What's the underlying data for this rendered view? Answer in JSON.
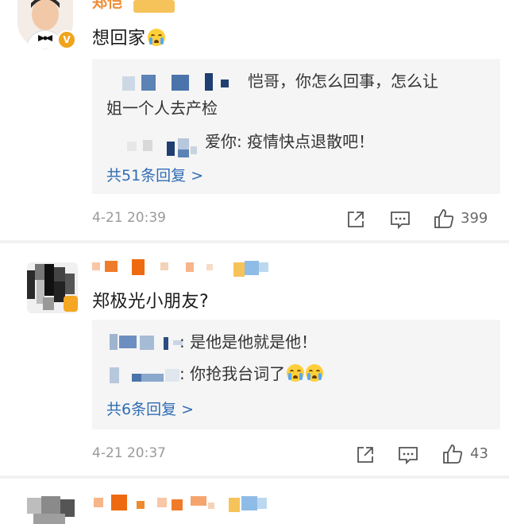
{
  "comments": [
    {
      "username": "郑恺",
      "badge": "V",
      "text": "想回家",
      "replies": [
        {
          "text": "恺哥，你怎么回事，怎么让"
        },
        {
          "text": "姐一个人去产检"
        },
        {
          "text": "爱你: 疫情快点退散吧！"
        }
      ],
      "more_replies": "共51条回复 >",
      "timestamp": "4-21 20:39",
      "like_count": "399"
    },
    {
      "text": "郑极光小朋友?",
      "replies": [
        {
          "text": ": 是他是他就是他！"
        },
        {
          "text": ": 你抢我台词了"
        }
      ],
      "more_replies": "共6条回复 >",
      "timestamp": "4-21 20:37",
      "like_count": "43"
    }
  ],
  "icons": {
    "share": "share-icon",
    "comment": "comment-icon",
    "like": "thumbs-up-icon",
    "emoji": "crying-emoji-icon"
  },
  "colors": {
    "link": "#2f6db5",
    "reply_bg": "#f5f5f5",
    "badge": "#f0a41c",
    "timestamp": "#9a9a9a"
  }
}
